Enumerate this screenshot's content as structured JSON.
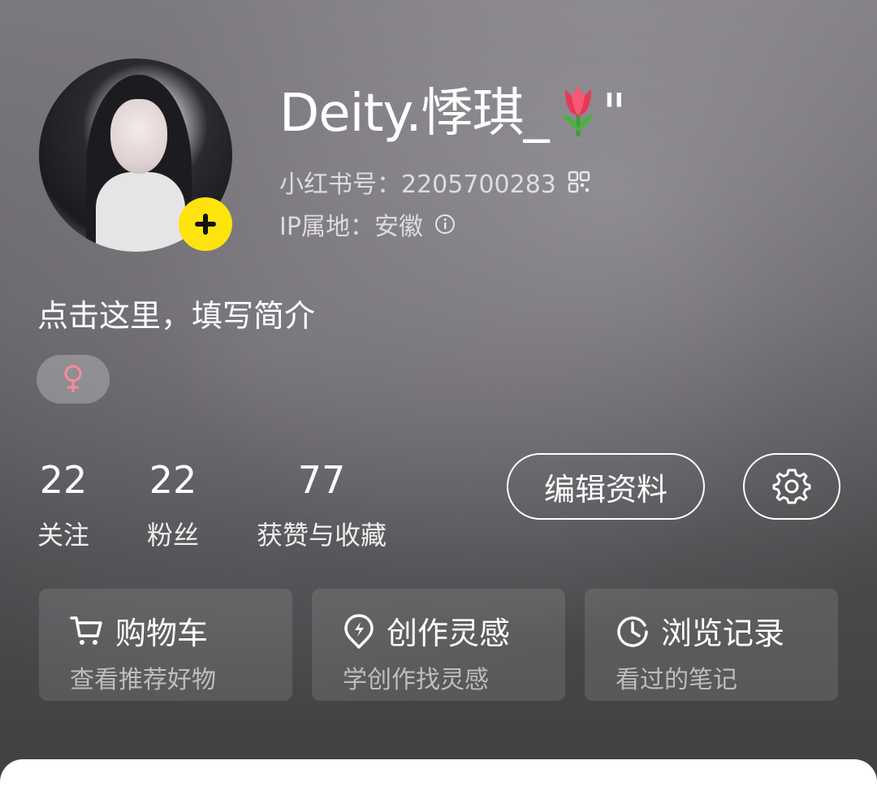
{
  "profile": {
    "username": "Deity.悸琪_",
    "username_suffix": "\"",
    "account_label": "小红书号：",
    "account_id": "2205700283",
    "ip_label": "IP属地：",
    "ip_location": "安徽",
    "bio": "点击这里，填写简介",
    "gender_symbol": "♀"
  },
  "stats": [
    {
      "value": "22",
      "label": "关注"
    },
    {
      "value": "22",
      "label": "粉丝"
    },
    {
      "value": "77",
      "label": "获赞与收藏"
    }
  ],
  "actions": {
    "edit_label": "编辑资料"
  },
  "shortcuts": [
    {
      "title": "购物车",
      "subtitle": "查看推荐好物",
      "icon": "cart-icon"
    },
    {
      "title": "创作灵感",
      "subtitle": "学创作找灵感",
      "icon": "lightbulb-icon"
    },
    {
      "title": "浏览记录",
      "subtitle": "看过的笔记",
      "icon": "clock-icon"
    }
  ],
  "colors": {
    "accent_yellow": "#ffe30f",
    "gender_pink": "#f58c9c"
  }
}
